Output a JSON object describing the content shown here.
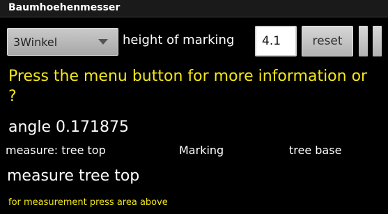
{
  "app": {
    "title": "Baumhoehenmesser"
  },
  "toolbar": {
    "method_spinner": {
      "selected": "3Winkel"
    },
    "marking_label": "height of marking",
    "marking_height_value": "4.1",
    "reset_label": "reset"
  },
  "main": {
    "info_text": "Press the menu button for more information or ?",
    "angle_text": "angle 0.171875",
    "targets": {
      "tree_top": "measure: tree top",
      "marking": "Marking",
      "tree_base": "tree base"
    },
    "status_text": "measure tree top",
    "hint_text": "for measurement press area above"
  },
  "colors": {
    "background": "#000000",
    "accent_text": "#f2e61a",
    "text": "#ffffff"
  }
}
